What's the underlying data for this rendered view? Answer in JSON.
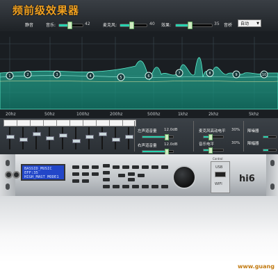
{
  "app": {
    "title": "频前级效果器",
    "accent_color": "#27d3b0",
    "title_color": "#f0a020"
  },
  "top_controls": [
    {
      "label": "静音",
      "name": "mute"
    },
    {
      "label": "音乐:",
      "value": "42",
      "level_percent": 42
    },
    {
      "label": "麦克风:",
      "value": "40",
      "level_percent": 40
    },
    {
      "label": "效果:",
      "value": "35",
      "level_percent": 35
    },
    {
      "label": "音桥",
      "name": "bridge"
    }
  ],
  "mode_select": {
    "value": "自动",
    "icon": "chevron-down-icon"
  },
  "eq": {
    "frequency_labels": [
      "20hz",
      "50hz",
      "100hz",
      "200hz",
      "500hz",
      "1khz",
      "2khz",
      "5khz"
    ],
    "band_nodes": [
      "1",
      "2",
      "3",
      "4",
      "5",
      "6",
      "7",
      "8",
      "9",
      "10"
    ]
  },
  "mixer": {
    "channel_count": 10,
    "channels": [
      "",
      "",
      "",
      "",
      "",
      "",
      "",
      "",
      "",
      ""
    ],
    "right_panel": [
      {
        "label": "左声道音量",
        "value": "12.0dB",
        "level_percent": 75
      },
      {
        "label": "右声道音量",
        "value": "12.0dB",
        "level_percent": 75
      },
      {
        "label": "麦克风高动电平",
        "value": "30%",
        "level_percent": 30
      },
      {
        "label": "音乐电平",
        "value": "30%",
        "level_percent": 30
      },
      {
        "label": "降噪器",
        "value": ""
      },
      {
        "label": "降幅器",
        "value": ""
      }
    ]
  },
  "hardware": {
    "lcd_line1": "BASSID_MUSIC EFF:35",
    "lcd_line2": "HIGH_MAST MODE1",
    "group_label": "Control",
    "usb_label": "USB",
    "wifi_label": "WIFI",
    "logo": "hi6"
  },
  "footer": {
    "watermark": "www.guang"
  }
}
